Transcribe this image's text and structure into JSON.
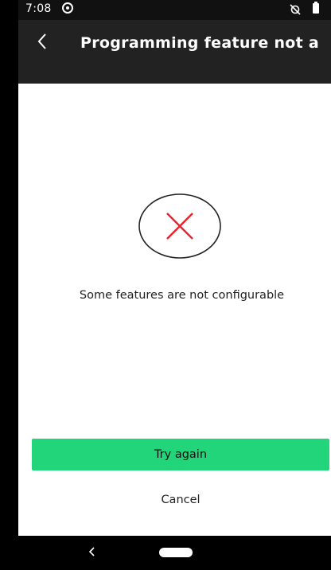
{
  "status_bar": {
    "time": "7:08",
    "icons": [
      "sync-icon",
      "alarm-off-icon",
      "battery-icon"
    ]
  },
  "app_bar": {
    "title": "Programming feature not a...",
    "back_icon": "back-chevron-icon"
  },
  "content": {
    "error_icon": "error-x-icon",
    "error_color": "#e8232b",
    "message": "Some features are not configurable"
  },
  "actions": {
    "try_again_label": "Try again",
    "try_again_color": "#22d47a",
    "cancel_label": "Cancel"
  },
  "nav_bar": {
    "icons": [
      "nav-back-icon",
      "nav-home-pill"
    ]
  }
}
